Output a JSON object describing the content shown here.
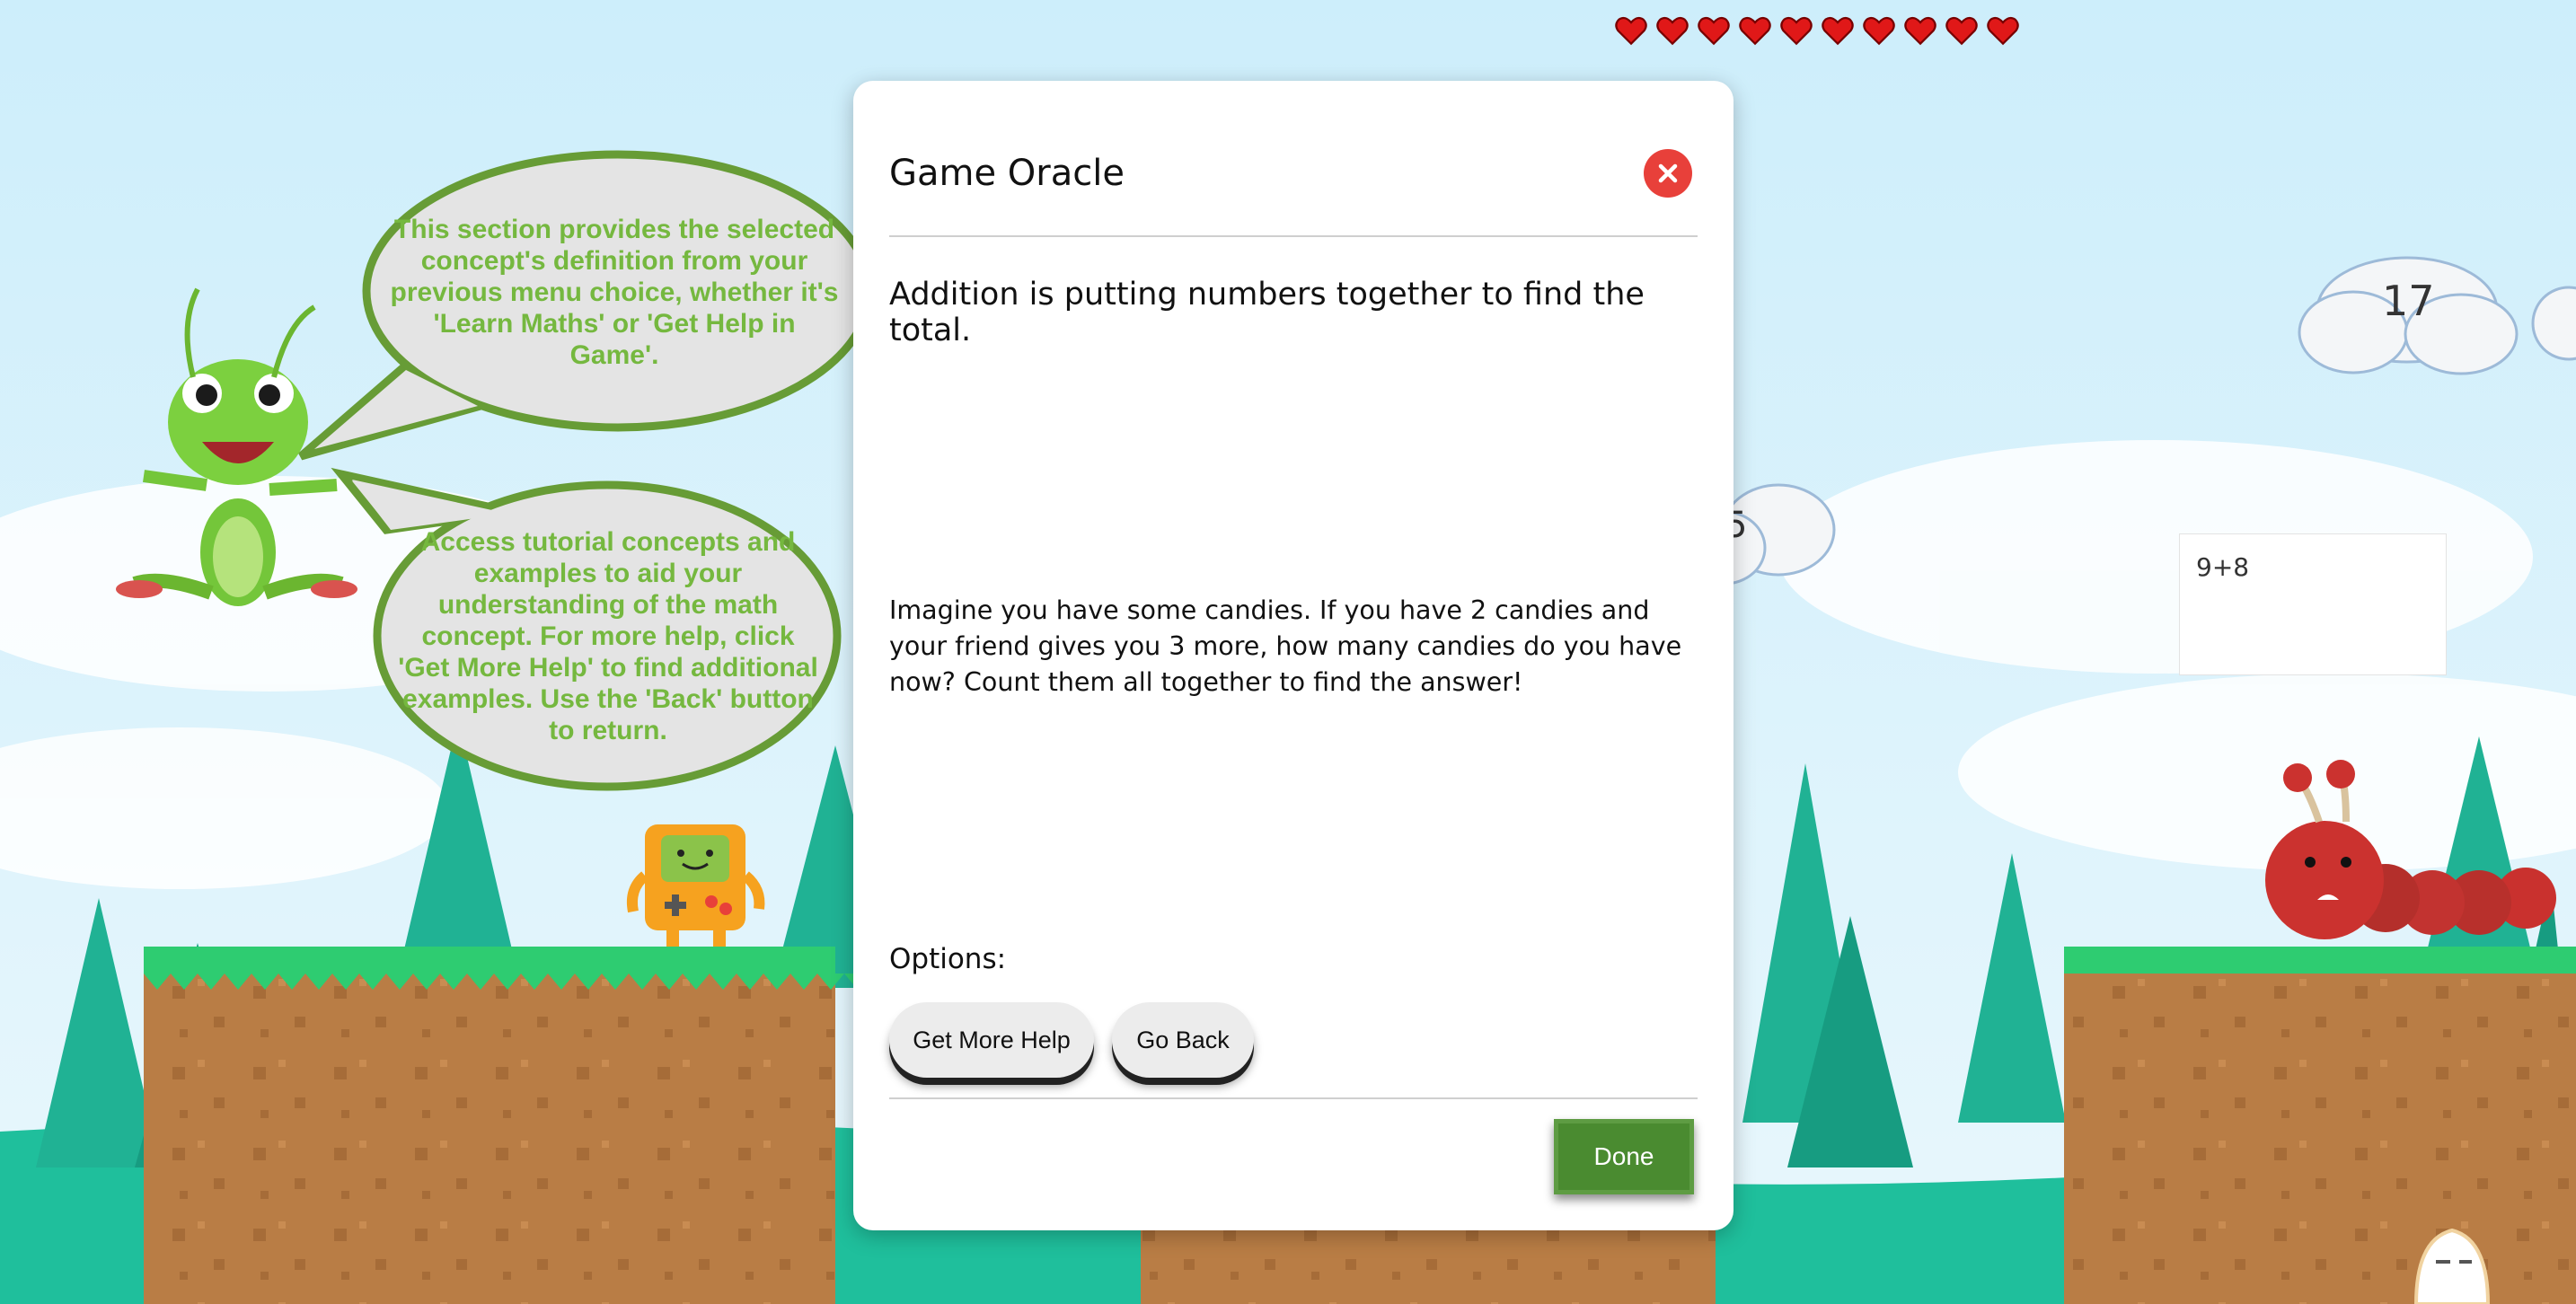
{
  "hud": {
    "lives": 10
  },
  "clouds": {
    "target_number": "17",
    "partial_number": "5"
  },
  "answer_box": {
    "value": "9+8"
  },
  "guide_bubbles": {
    "bubble1": "This section provides the selected concept's definition from your previous menu choice, whether it's 'Learn Maths' or 'Get Help in Game'.",
    "bubble2": "Access tutorial concepts and examples to aid your understanding of the math concept. For more help, click 'Get More Help' to find additional examples. Use the 'Back' button to return."
  },
  "modal": {
    "title": "Game Oracle",
    "definition": "Addition is putting numbers together to find the total.",
    "example": "Imagine you have some candies. If you have 2 candies and your friend gives you 3 more, how many candies do you have now? Count them all together to find the answer!",
    "options_label": "Options:",
    "buttons": {
      "more_help": "Get More Help",
      "go_back": "Go Back",
      "done": "Done"
    }
  },
  "colors": {
    "sky": "#cfeefa",
    "grass": "#2ecc71",
    "dirt": "#b97d45",
    "modal_close": "#e8403a",
    "done": "#4a8b30",
    "bubble_text": "#75b83f"
  }
}
